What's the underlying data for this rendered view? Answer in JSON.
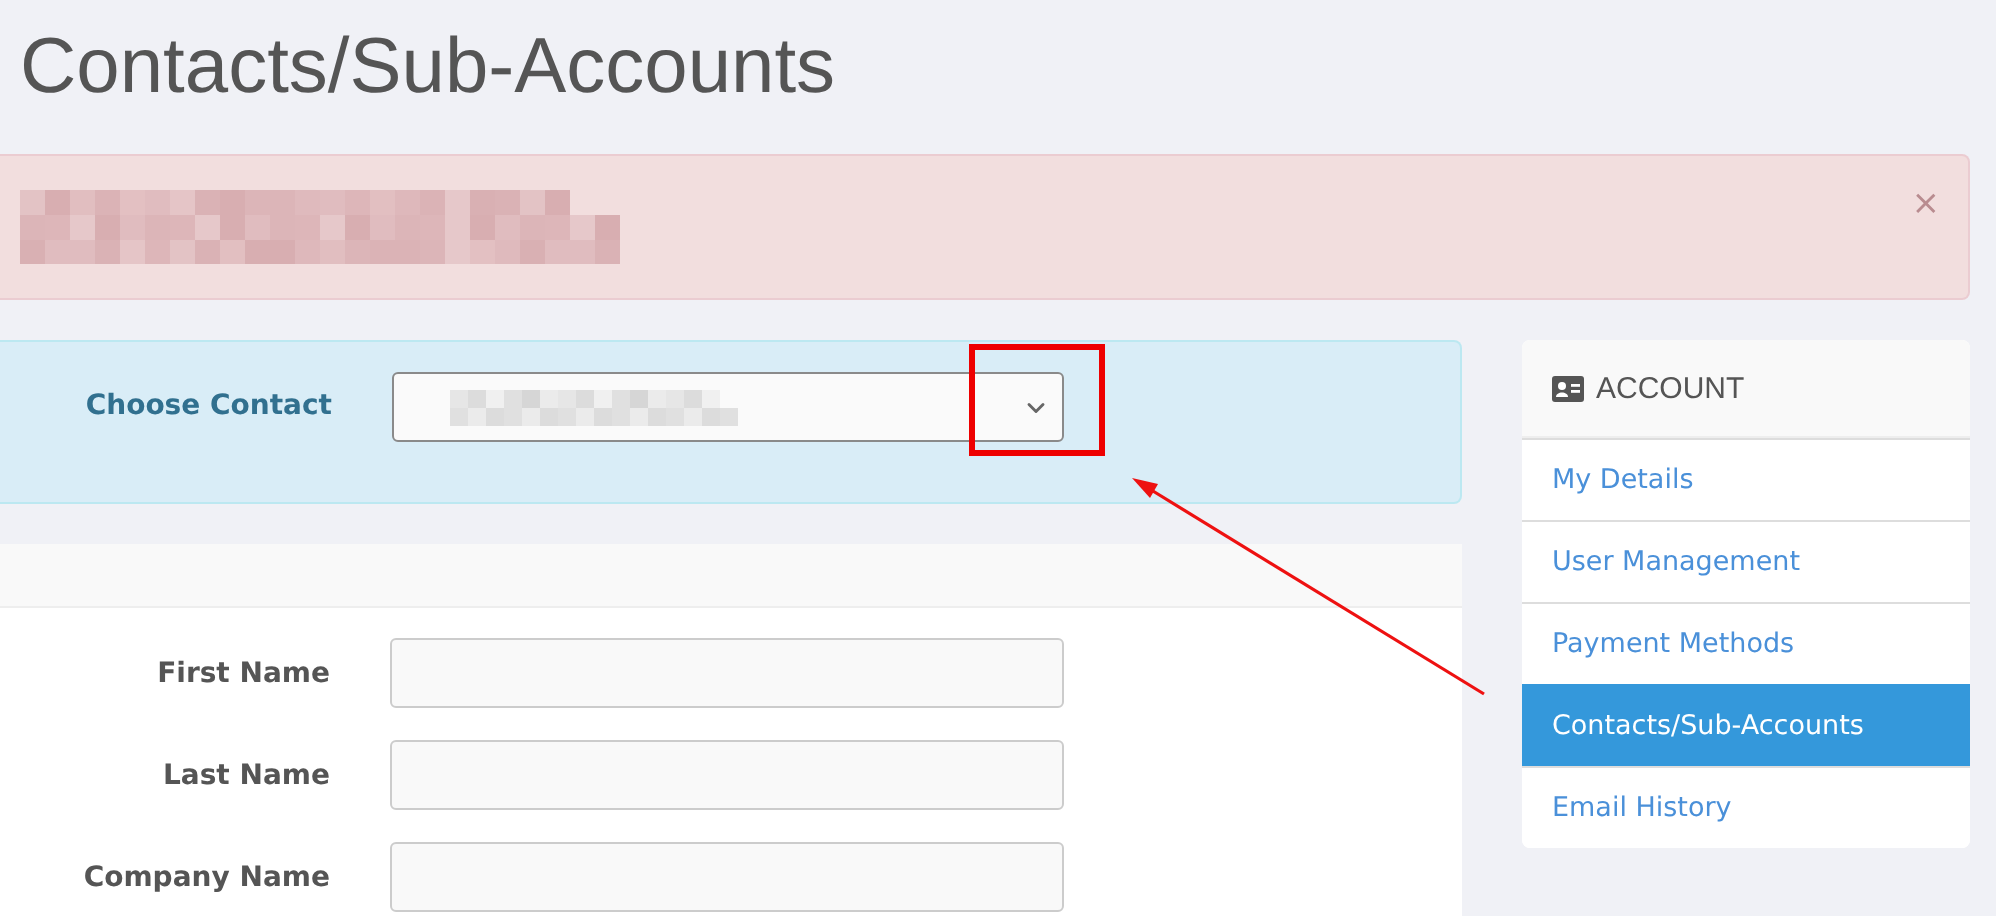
{
  "title": "Contacts/Sub-Accounts",
  "alert": {
    "close": "×"
  },
  "contact_chooser": {
    "label": "Choose Contact"
  },
  "form": {
    "fields": [
      {
        "label": "First Name"
      },
      {
        "label": "Last Name"
      },
      {
        "label": "Company Name"
      }
    ]
  },
  "sidebar": {
    "heading": "ACCOUNT",
    "items": [
      {
        "label": "My Details",
        "selected": false
      },
      {
        "label": "User Management",
        "selected": false
      },
      {
        "label": "Payment Methods",
        "selected": false
      },
      {
        "label": "Contacts/Sub-Accounts",
        "selected": true
      },
      {
        "label": "Email History",
        "selected": false
      }
    ]
  }
}
